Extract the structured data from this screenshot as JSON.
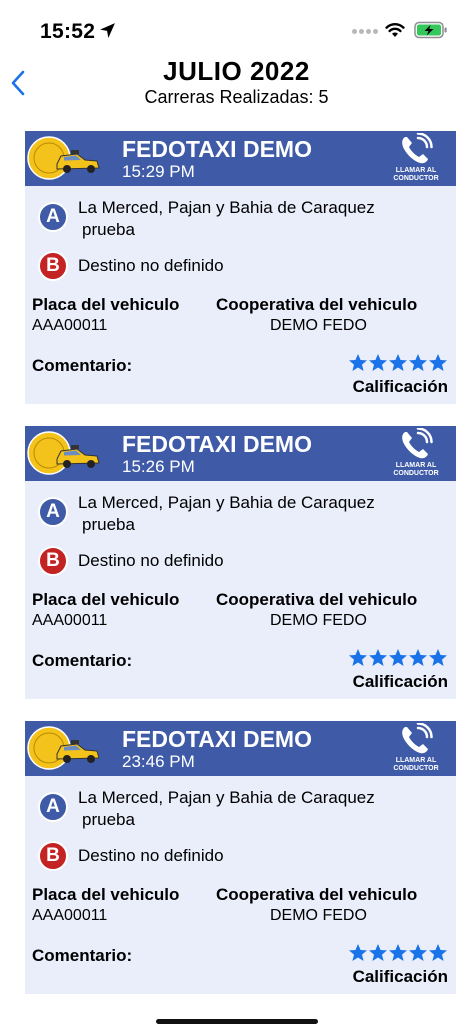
{
  "status_bar": {
    "time": "15:52",
    "battery_color": "#34c759"
  },
  "header": {
    "title": "JULIO  2022",
    "subtitle": "Carreras Realizadas: 5"
  },
  "colors": {
    "accent": "#3f5ba8",
    "card_bg": "#eaeefb",
    "badge_a": "#3f5ba8",
    "badge_b": "#c42323",
    "star": "#1a73e8"
  },
  "call_button_label": "LLAMAR AL CONDUCTOR",
  "labels": {
    "plate": "Placa del vehiculo",
    "coop": "Cooperativa del vehiculo",
    "comment": "Comentario:",
    "rating": "Calificación",
    "origin_badge": "A",
    "dest_badge": "B"
  },
  "rides": [
    {
      "driver": "FEDOTAXI DEMO",
      "time": "15:29 PM",
      "origin_line1": "La Merced,  Pajan y Bahia de Caraquez",
      "origin_line2": "prueba",
      "destination": "Destino no definido",
      "plate": "AAA00011",
      "coop": "DEMO FEDO",
      "rating": 5
    },
    {
      "driver": "FEDOTAXI DEMO",
      "time": "15:26 PM",
      "origin_line1": "La Merced,  Pajan y Bahia de Caraquez",
      "origin_line2": "prueba",
      "destination": "Destino no definido",
      "plate": "AAA00011",
      "coop": "DEMO FEDO",
      "rating": 5
    },
    {
      "driver": "FEDOTAXI DEMO",
      "time": "23:46 PM",
      "origin_line1": "La Merced,  Pajan y Bahia de Caraquez",
      "origin_line2": "prueba",
      "destination": "Destino no definido",
      "plate": "AAA00011",
      "coop": "DEMO FEDO",
      "rating": 5
    }
  ]
}
